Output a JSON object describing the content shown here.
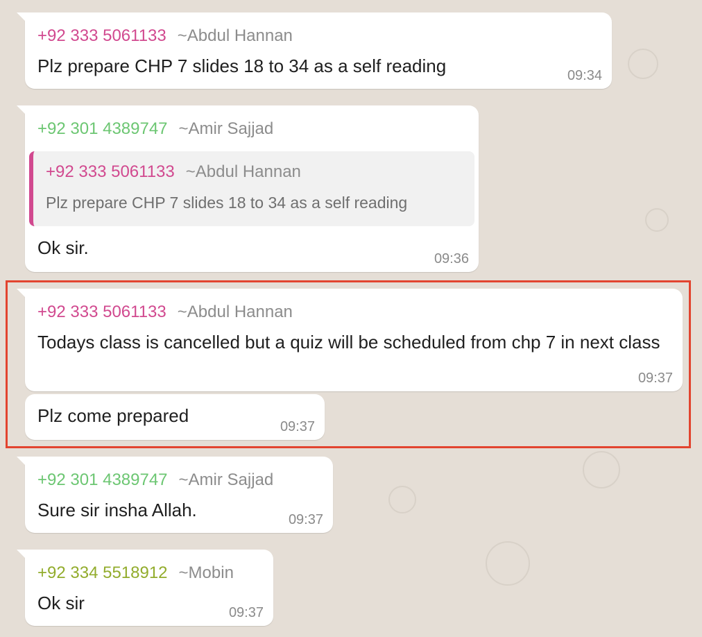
{
  "messages": [
    {
      "phone": "+92 333 5061133",
      "alias": "~Abdul Hannan",
      "text": "Plz prepare CHP 7 slides 18 to 34 as a self reading",
      "time": "09:34"
    },
    {
      "phone": "+92 301 4389747",
      "alias": "~Amir Sajjad",
      "quote": {
        "phone": "+92 333 5061133",
        "alias": "~Abdul Hannan",
        "text": "Plz prepare CHP 7 slides 18 to 34 as a self reading"
      },
      "text": "Ok sir.",
      "time": "09:36"
    },
    {
      "phone": "+92 333 5061133",
      "alias": "~Abdul Hannan",
      "text": "Todays class is cancelled but a quiz will be scheduled from chp 7 in next class",
      "time": "09:37"
    },
    {
      "text": "Plz come prepared",
      "time": "09:37"
    },
    {
      "phone": "+92 301 4389747",
      "alias": "~Amir Sajjad",
      "text": "Sure sir insha Allah.",
      "time": "09:37"
    },
    {
      "phone": "+92 334 5518912",
      "alias": "~Mobin",
      "text": "Ok sir",
      "time": "09:37"
    }
  ],
  "colors": {
    "highlight_border": "#e2442f",
    "chat_background": "#e5ded6",
    "bubble": "#ffffff",
    "sender_pink": "#d1498f",
    "sender_green": "#6cc672",
    "sender_olive": "#92ac2c"
  }
}
